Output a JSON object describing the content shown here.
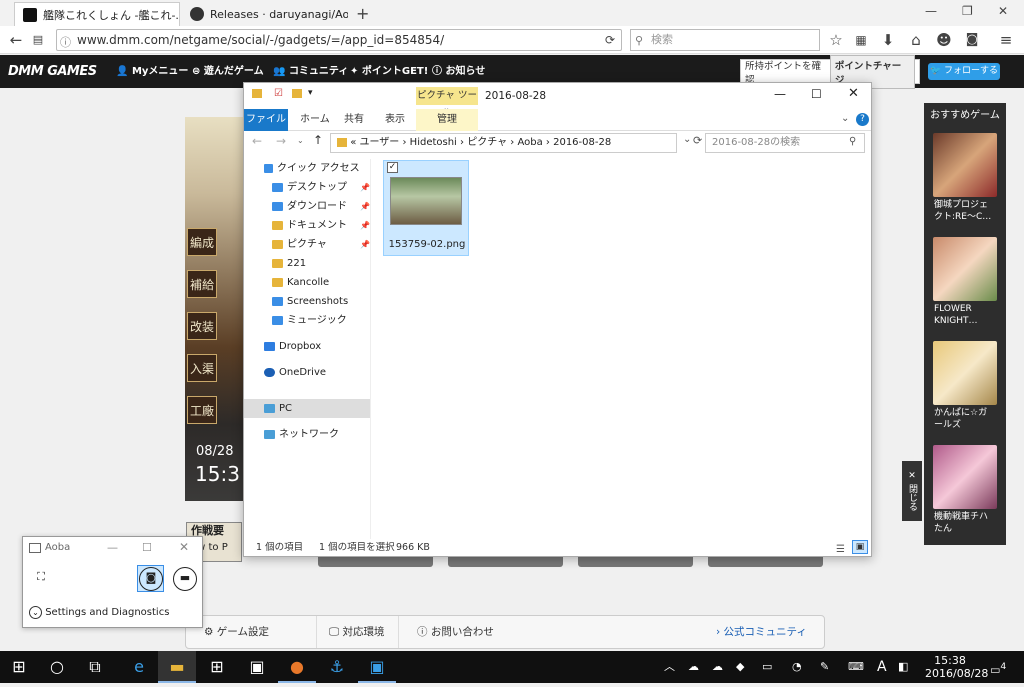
{
  "browser": {
    "tabs": [
      {
        "title": "艦隊これくしょん -艦これ-...",
        "active": true
      },
      {
        "title": "Releases · daruyanagi/Aob...",
        "active": false
      }
    ],
    "new_tab": "+",
    "url": "www.dmm.com/netgame/social/-/gadgets/=/app_id=854854/",
    "search_placeholder": "検索",
    "window_controls": [
      "—",
      "❐",
      "✕"
    ]
  },
  "dmm": {
    "logo": "DMM GAMES",
    "menu": [
      "Myメニュー",
      "遊んだゲーム",
      "コミュニティ",
      "ポイントGET!",
      "お知らせ"
    ],
    "points_check": "所持ポイントを確認",
    "points_charge": "ポイントチャージ",
    "follow": "フォローする"
  },
  "game": {
    "buttons": [
      "編成",
      "補給",
      "改装",
      "入渠",
      "工廠"
    ],
    "date": "08/28",
    "time": "15:3",
    "sakusen": "作戦要",
    "how_to": "ow to P"
  },
  "bottom_bar": {
    "items": [
      "ゲーム設定",
      "対応環境",
      "お問い合わせ"
    ],
    "community": "公式コミュニティ"
  },
  "side": {
    "title": "おすすめゲーム",
    "games": [
      {
        "title": "御城プロジェクト:RE〜C…"
      },
      {
        "title": "FLOWER KNIGHT…"
      },
      {
        "title": "かんぱに☆ガールズ"
      },
      {
        "title": "機動戦車チハたん"
      }
    ],
    "close": "閉じる"
  },
  "explorer": {
    "title": "2016-08-28",
    "picture_tools": "ピクチャ ツール",
    "ribbon_tabs": [
      "ファイル",
      "ホーム",
      "共有",
      "表示",
      "管理"
    ],
    "address": [
      "«",
      "ユーザー",
      "Hidetoshi",
      "ピクチャ",
      "Aoba",
      "2016-08-28"
    ],
    "search_placeholder": "2016-08-28の検索",
    "nav": [
      {
        "label": "クイック アクセス"
      },
      {
        "label": "デスクトップ"
      },
      {
        "label": "ダウンロード"
      },
      {
        "label": "ドキュメント"
      },
      {
        "label": "ピクチャ"
      },
      {
        "label": "221"
      },
      {
        "label": "Kancolle"
      },
      {
        "label": "Screenshots"
      },
      {
        "label": "ミュージック"
      },
      {
        "label": "Dropbox"
      },
      {
        "label": "OneDrive"
      },
      {
        "label": "PC"
      },
      {
        "label": "ネットワーク"
      }
    ],
    "file": "153759-02.png",
    "status_count": "1 個の項目",
    "status_selected": "1 個の項目を選択",
    "status_size": "966 KB"
  },
  "aoba": {
    "title": "Aoba",
    "settings": "Settings and Diagnostics"
  },
  "taskbar": {
    "time": "15:38",
    "date": "2016/08/28",
    "ime": "A",
    "notifications": "4"
  }
}
